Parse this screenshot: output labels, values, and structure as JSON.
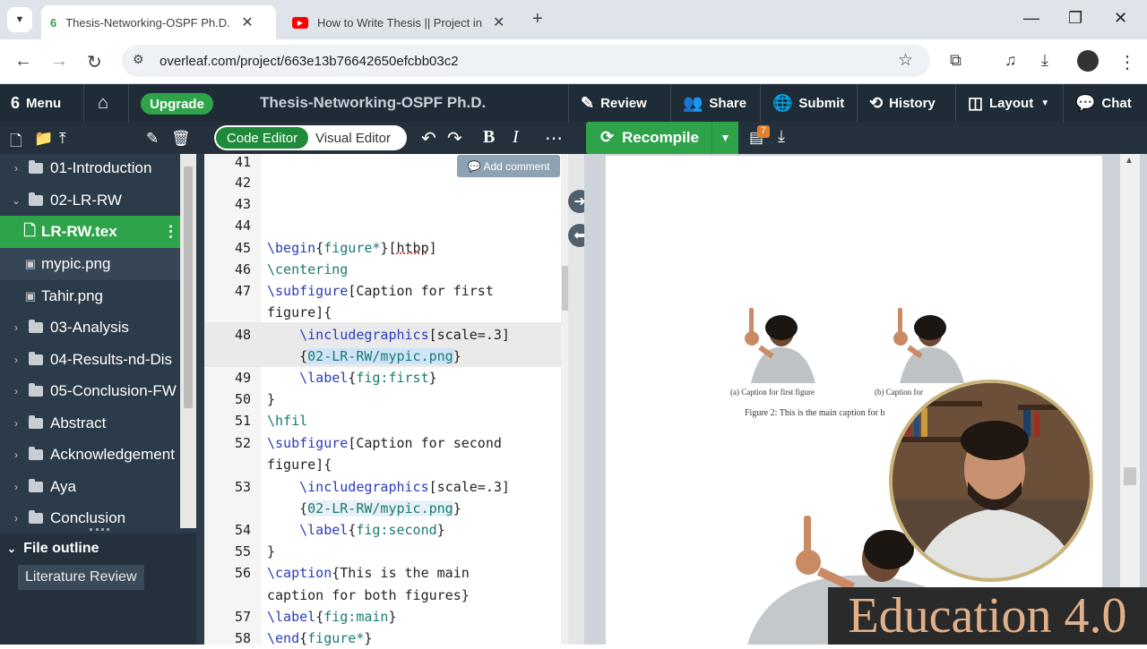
{
  "browser": {
    "tabs": [
      {
        "title": "Thesis-Networking-OSPF Ph.D. - Online LaTeX Editor Overleaf",
        "active": true
      },
      {
        "title": "How to Write Thesis || Project in Overleaf",
        "active": false
      }
    ],
    "url": "overleaf.com/project/663e13b76642650efcbb03c2"
  },
  "toolbar": {
    "menu_label": "Menu",
    "upgrade_label": "Upgrade",
    "project_title": "Thesis-Networking-OSPF Ph.D.",
    "review_label": "Review",
    "share_label": "Share",
    "submit_label": "Submit",
    "history_label": "History",
    "layout_label": "Layout",
    "chat_label": "Chat"
  },
  "file_tree": {
    "items": [
      {
        "label": "01-Introduction",
        "type": "folder",
        "expanded": false
      },
      {
        "label": "02-LR-RW",
        "type": "folder",
        "expanded": true
      },
      {
        "label": "LR-RW.tex",
        "type": "file",
        "selected": true
      },
      {
        "label": "mypic.png",
        "type": "image"
      },
      {
        "label": "Tahir.png",
        "type": "image"
      },
      {
        "label": "03-Analysis",
        "type": "folder"
      },
      {
        "label": "04-Results-nd-Dis",
        "type": "folder"
      },
      {
        "label": "05-Conclusion-FW",
        "type": "folder"
      },
      {
        "label": "Abstract",
        "type": "folder"
      },
      {
        "label": "Acknowledgement",
        "type": "folder"
      },
      {
        "label": "Aya",
        "type": "folder"
      },
      {
        "label": "Conclusion",
        "type": "folder"
      }
    ],
    "outline_title": "File outline",
    "outline_item": "Literature Review"
  },
  "editor": {
    "code_editor_label": "Code Editor",
    "visual_editor_label": "Visual Editor",
    "add_comment_label": "Add comment",
    "line_numbers": [
      "41",
      "42",
      "43",
      "44",
      "45",
      "46",
      "47",
      "48",
      "49",
      "50",
      "51",
      "52",
      "53",
      "54",
      "55",
      "56",
      "57",
      "58"
    ]
  },
  "pdf": {
    "recompile_label": "Recompile",
    "log_badge": "7",
    "subcaption_a": "(a) Caption for first figure",
    "subcaption_b": "(b) Caption for",
    "figure_caption": "Figure 2: This is the main caption for b"
  },
  "overlay": {
    "brand_text": "Education 4.0"
  },
  "colors": {
    "overleaf_green": "#2fa34a",
    "toolbar_dark": "#1f2b37",
    "sidebar": "#2c3b49"
  }
}
